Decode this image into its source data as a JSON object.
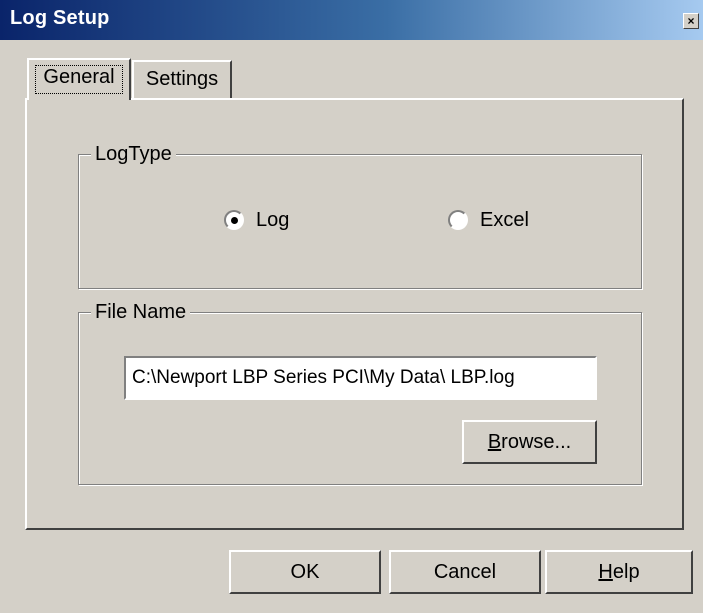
{
  "window": {
    "title": "Log Setup",
    "close_glyph": "×"
  },
  "tabs": [
    {
      "label": "General",
      "selected": true
    },
    {
      "label": "Settings",
      "selected": false
    }
  ],
  "log_type_group": {
    "label": "LogType",
    "options": [
      {
        "label": "Log",
        "selected": true
      },
      {
        "label": "Excel",
        "selected": false
      }
    ]
  },
  "file_name_group": {
    "label": "File Name",
    "path_value": "C:\\Newport LBP Series PCI\\My Data\\ LBP.log",
    "browse_label_underlined": "B",
    "browse_label_rest": "rowse..."
  },
  "footer_buttons": {
    "ok_label": "OK",
    "cancel_label": "Cancel",
    "help_label_underlined": "H",
    "help_label_rest": "elp"
  }
}
